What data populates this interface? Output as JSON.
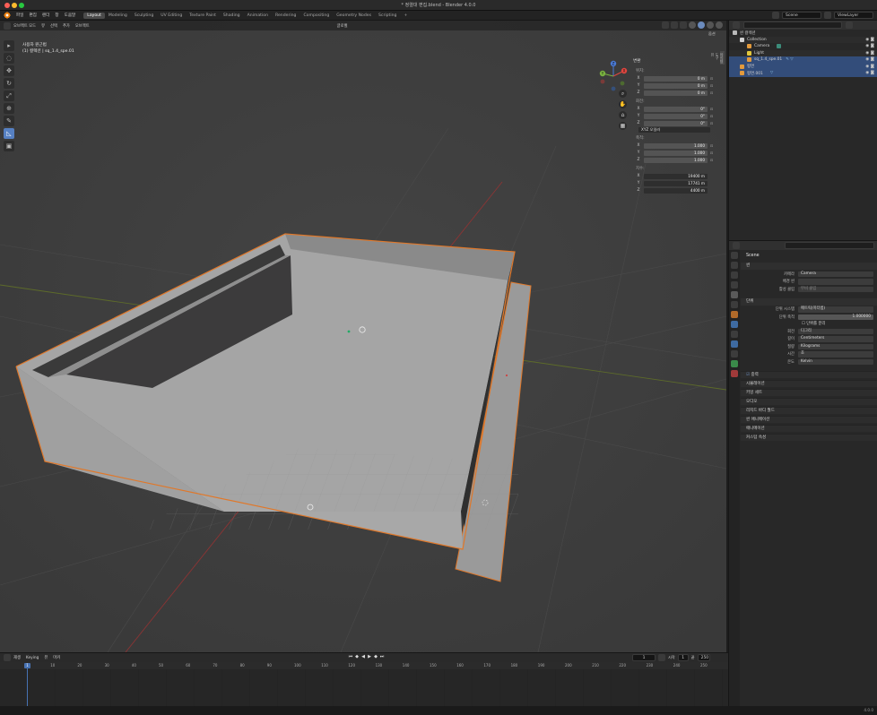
{
  "window": {
    "title": "* 정렬대 편집.blend - Blender 4.0.0"
  },
  "menu": {
    "items": [
      "파일",
      "편집",
      "렌더",
      "창",
      "도움말"
    ]
  },
  "workspaces": [
    {
      "label": "Layout",
      "active": true
    },
    {
      "label": "Modeling"
    },
    {
      "label": "Sculpting"
    },
    {
      "label": "UV Editing"
    },
    {
      "label": "Texture Paint"
    },
    {
      "label": "Shading"
    },
    {
      "label": "Animation"
    },
    {
      "label": "Rendering"
    },
    {
      "label": "Compositing"
    },
    {
      "label": "Geometry Nodes"
    },
    {
      "label": "Scripting"
    },
    {
      "label": "+"
    }
  ],
  "top_right": {
    "scene_label": "Scene",
    "view_layer_label": "ViewLayer"
  },
  "viewport": {
    "header_items": [
      "오브젝트 모드",
      "뷰",
      "선택",
      "추가",
      "오브젝트"
    ],
    "transform_orientation": "글로벌",
    "options_label": "옵션",
    "info_line1": "사용자 원근법",
    "info_line2": "(1) 컬렉션 | sq_1.4_spe.01",
    "tool_icons": [
      "cursor-icon",
      "select-circle-icon",
      "move-icon",
      "rotate-icon",
      "scale-icon",
      "transform-icon",
      "annotate-icon",
      "measure-icon",
      "add-cube-icon"
    ],
    "gizmo_axes": {
      "x": "X",
      "y": "Y",
      "z": "Z"
    }
  },
  "npanel": {
    "header": "변환",
    "tabs": [
      "아이템",
      "도구",
      "뷰"
    ],
    "location_label": "위치:",
    "location": [
      {
        "axis": "X",
        "value": "0 m"
      },
      {
        "axis": "Y",
        "value": "0 m"
      },
      {
        "axis": "Z",
        "value": "0 m"
      }
    ],
    "rotation_label": "회전:",
    "rotation": [
      {
        "axis": "X",
        "value": "0°"
      },
      {
        "axis": "Y",
        "value": "0°"
      },
      {
        "axis": "Z",
        "value": "0°"
      }
    ],
    "rotation_mode": "XYZ 오일러",
    "scale_label": "축척:",
    "scale": [
      {
        "axis": "X",
        "value": "1.000"
      },
      {
        "axis": "Y",
        "value": "1.000"
      },
      {
        "axis": "Z",
        "value": "1.000"
      }
    ],
    "dimensions_label": "치수:",
    "dimensions": [
      {
        "axis": "X",
        "value": "19400 m"
      },
      {
        "axis": "Y",
        "value": "17741 m"
      },
      {
        "axis": "Z",
        "value": "4400 m"
      }
    ]
  },
  "outliner": {
    "search_placeholder": "",
    "rows": [
      {
        "label": "씬 컬렉션",
        "indent": 0,
        "icon_color": "#b9b9b9"
      },
      {
        "label": "Collection",
        "indent": 1,
        "icon_color": "#d0d0d0"
      },
      {
        "label": "Camera",
        "indent": 2,
        "icon_color": "#e39a3c"
      },
      {
        "label": "Light",
        "indent": 2,
        "icon_color": "#e3c83c"
      },
      {
        "label": "sq_1.4_spe.01",
        "indent": 2,
        "icon_color": "#e39a3c",
        "selected": true
      },
      {
        "label": "평면",
        "indent": 1,
        "icon_color": "#e39a3c",
        "selected": true
      },
      {
        "label": "평면.001",
        "indent": 1,
        "icon_color": "#e39a3c",
        "selected": true
      }
    ]
  },
  "properties": {
    "title": "Scene",
    "scene_section": "씬",
    "camera_label": "카메라",
    "camera_value": "Camera",
    "background_label": "배경 씬",
    "background_value": "",
    "active_clip_label": "활성 클립",
    "active_clip_value": "무비 클립",
    "units_section": "단위",
    "unit_system_label": "단위 시스템",
    "unit_system_value": "메트릭(미터법)",
    "unit_scale_label": "단위 축척",
    "unit_scale_value": "1.000000",
    "separate_units_label": "단위를 분리",
    "rotation_label": "회전",
    "rotation_value": "디그리",
    "length_label": "길이",
    "length_value": "Centimeters",
    "mass_label": "질량",
    "mass_value": "Kilograms",
    "time_label": "시간",
    "time_value": "초",
    "temperature_label": "온도",
    "temperature_value": "Kelvin",
    "collapsed_sections": [
      "중력",
      "시뮬레이션",
      "키잉 세트",
      "오디오",
      "리지드 바디 월드",
      "애니메이션",
      "커스텀 속성"
    ],
    "extra_sections": [
      "씬 애니메이션"
    ]
  },
  "timeline": {
    "header_items": [
      "재생",
      "Keying",
      "뷰",
      "마커"
    ],
    "current_frame": "1",
    "start_label": "시작",
    "start_value": "1",
    "end_label": "끝",
    "end_value": "250",
    "ticks": [
      "1",
      "10",
      "20",
      "30",
      "40",
      "50",
      "60",
      "70",
      "80",
      "90",
      "100",
      "110",
      "120",
      "130",
      "140",
      "150",
      "160",
      "170",
      "180",
      "190",
      "200",
      "210",
      "220",
      "230",
      "240",
      "250"
    ]
  },
  "statusbar": {
    "version": "4.0.0"
  }
}
